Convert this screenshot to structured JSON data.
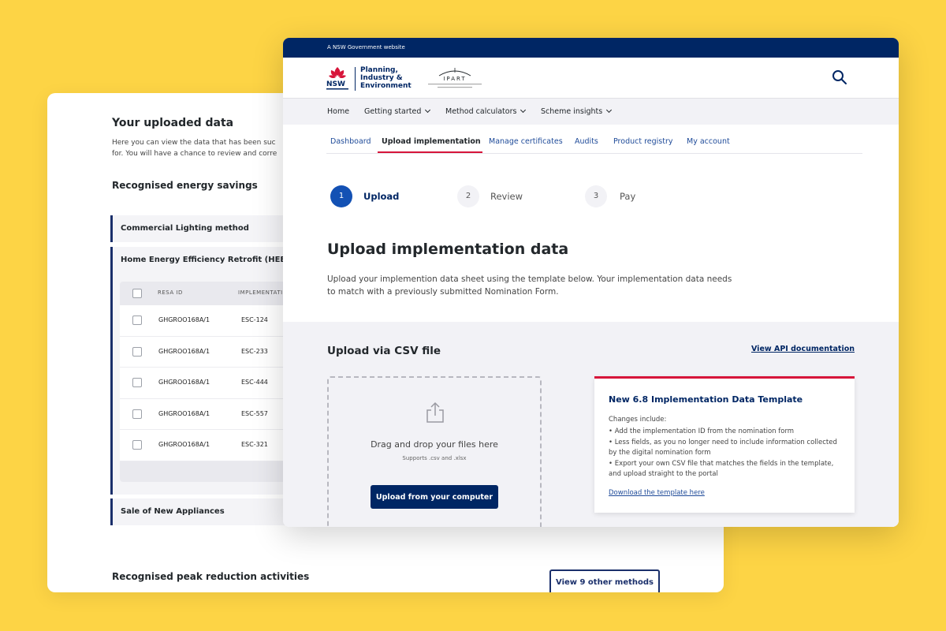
{
  "colors": {
    "page_background": "#fdd445",
    "nsw_navy": "#002664",
    "accent_blue": "#1351b4",
    "accent_red": "#d7153a",
    "panel_grey": "#f2f2f6"
  },
  "back_page": {
    "title": "Your uploaded data",
    "intro_lines": [
      "Here you can view the data that has been suc",
      "for. You will have a chance to review and corre"
    ],
    "section_heading": "Recognised energy savings",
    "accordions": [
      "Commercial Lighting method",
      "Home Energy Efficiency Retrofit (HEER) m",
      "Sale of New Appliances"
    ],
    "table": {
      "headers": [
        "RESA ID",
        "IMPLEMENTATI"
      ],
      "rows": [
        {
          "resa_id": "GHGROO168A/1",
          "implementation": "ESC-124"
        },
        {
          "resa_id": "GHGROO168A/1",
          "implementation": "ESC-233"
        },
        {
          "resa_id": "GHGROO168A/1",
          "implementation": "ESC-444"
        },
        {
          "resa_id": "GHGROO168A/1",
          "implementation": "ESC-557"
        },
        {
          "resa_id": "GHGROO168A/1",
          "implementation": "ESC-321"
        }
      ]
    },
    "peak_heading": "Recognised peak reduction activities",
    "view_methods_button": "View 9 other methods"
  },
  "front_page": {
    "gov_bar": "A NSW Government website",
    "logo": {
      "nsw": "NSW",
      "dept_lines": [
        "Planning,",
        "Industry &",
        "Environment"
      ],
      "ipart": "IPART"
    },
    "icons": {
      "search": "search-icon",
      "upload": "upload-icon",
      "waratah": "waratah-icon"
    },
    "nav": [
      {
        "label": "Home",
        "dropdown": false
      },
      {
        "label": "Getting started",
        "dropdown": true
      },
      {
        "label": "Method calculators",
        "dropdown": true
      },
      {
        "label": "Scheme insights",
        "dropdown": true
      }
    ],
    "tabs": [
      {
        "label": "Dashboard",
        "active": false
      },
      {
        "label": "Upload implementation",
        "active": true
      },
      {
        "label": "Manage certificates",
        "active": false
      },
      {
        "label": "Audits",
        "active": false
      },
      {
        "label": "Product registry",
        "active": false
      },
      {
        "label": "My account",
        "active": false
      }
    ],
    "steps": [
      {
        "number": "1",
        "label": "Upload",
        "current": true
      },
      {
        "number": "2",
        "label": "Review",
        "current": false
      },
      {
        "number": "3",
        "label": "Pay",
        "current": false
      }
    ],
    "heading": "Upload implementation data",
    "description": "Upload your implemention data sheet using the template below. Your implementation data needs to match with a previously submitted Nomination Form.",
    "upload": {
      "heading": "Upload via CSV file",
      "api_link": "View API documentation",
      "dropzone_title": "Drag and drop your files here",
      "dropzone_subtitle": "Supports .csv and .xlsx",
      "dropzone_button": "Upload from your computer"
    },
    "template_card": {
      "title": "New 6.8 Implementation Data Template",
      "intro": "Changes include:",
      "items": [
        "• Add the implementation ID from the nomination form",
        "• Less fields, as you no longer need to include information collected by the digital nomination form",
        "• Export your own CSV file that matches the fields in the template, and upload straight to the portal"
      ],
      "link": "Download the template here"
    }
  }
}
